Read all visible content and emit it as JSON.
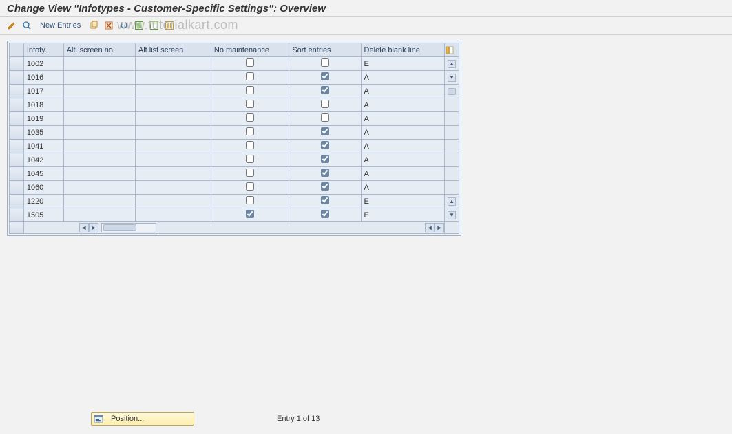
{
  "title": "Change View \"Infotypes - Customer-Specific Settings\": Overview",
  "watermark": "www.tutorialkart.com",
  "toolbar": {
    "new_entries": "New Entries"
  },
  "columns": {
    "infoty": "Infoty.",
    "alt_screen_no": "Alt. screen no.",
    "alt_list_screen": "Alt.list screen",
    "no_maintenance": "No maintenance",
    "sort_entries": "Sort entries",
    "delete_blank_line": "Delete blank line"
  },
  "rows": [
    {
      "infoty": "1002",
      "alt_screen_no": "",
      "alt_list_screen": "",
      "no_maint": false,
      "sort": false,
      "delete": "E"
    },
    {
      "infoty": "1016",
      "alt_screen_no": "",
      "alt_list_screen": "",
      "no_maint": false,
      "sort": true,
      "delete": "A"
    },
    {
      "infoty": "1017",
      "alt_screen_no": "",
      "alt_list_screen": "",
      "no_maint": false,
      "sort": true,
      "delete": "A"
    },
    {
      "infoty": "1018",
      "alt_screen_no": "",
      "alt_list_screen": "",
      "no_maint": false,
      "sort": false,
      "delete": "A"
    },
    {
      "infoty": "1019",
      "alt_screen_no": "",
      "alt_list_screen": "",
      "no_maint": false,
      "sort": false,
      "delete": "A"
    },
    {
      "infoty": "1035",
      "alt_screen_no": "",
      "alt_list_screen": "",
      "no_maint": false,
      "sort": true,
      "delete": "A"
    },
    {
      "infoty": "1041",
      "alt_screen_no": "",
      "alt_list_screen": "",
      "no_maint": false,
      "sort": true,
      "delete": "A"
    },
    {
      "infoty": "1042",
      "alt_screen_no": "",
      "alt_list_screen": "",
      "no_maint": false,
      "sort": true,
      "delete": "A"
    },
    {
      "infoty": "1045",
      "alt_screen_no": "",
      "alt_list_screen": "",
      "no_maint": false,
      "sort": true,
      "delete": "A"
    },
    {
      "infoty": "1060",
      "alt_screen_no": "",
      "alt_list_screen": "",
      "no_maint": false,
      "sort": true,
      "delete": "A"
    },
    {
      "infoty": "1220",
      "alt_screen_no": "",
      "alt_list_screen": "",
      "no_maint": false,
      "sort": true,
      "delete": "E"
    },
    {
      "infoty": "1505",
      "alt_screen_no": "",
      "alt_list_screen": "",
      "no_maint": true,
      "sort": true,
      "delete": "E"
    }
  ],
  "footer": {
    "position_label": "Position...",
    "entry_text": "Entry 1 of 13"
  }
}
